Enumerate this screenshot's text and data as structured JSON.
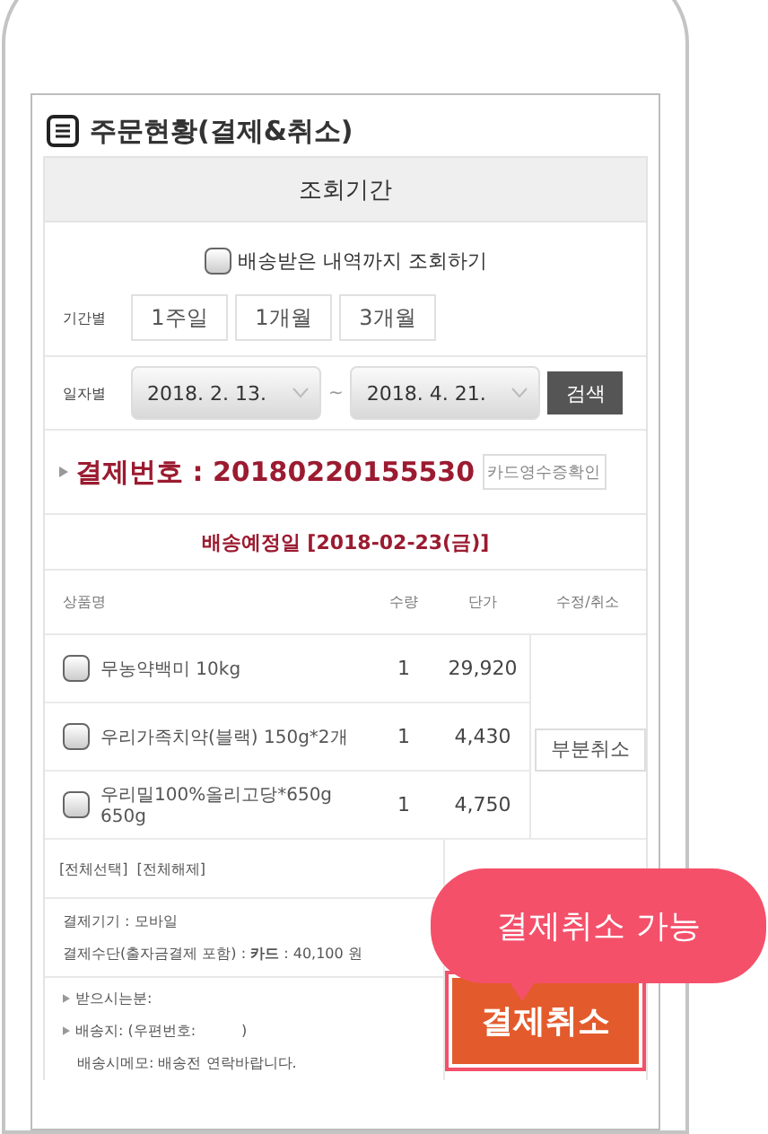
{
  "page_title": "주문현황(결제&취소)",
  "period_header": "조회기간",
  "include_delivered": {
    "label": "배송받은 내역까지 조회하기",
    "checked": false
  },
  "period_filter": {
    "label": "기간별",
    "options": [
      {
        "label": "1주일",
        "selected": false
      },
      {
        "label": "1개월",
        "selected": false
      },
      {
        "label": "3개월",
        "selected": false
      }
    ]
  },
  "date_filter": {
    "label": "일자별",
    "from": "2018. 2. 13.",
    "separator": "~",
    "to": "2018. 4. 21.",
    "search_button": "검색"
  },
  "payment": {
    "number": "결제번호 : 20180220155530",
    "receipt_button": "카드영수증확인",
    "delivery_date": "배송예정일 [2018-02-23(금)]"
  },
  "table": {
    "columns": [
      "상품명",
      "수량",
      "단가",
      "수정/취소"
    ],
    "rows": [
      {
        "name": "무농약백미 10kg",
        "qty": "1",
        "price": "29,920",
        "checked": false
      },
      {
        "name": "우리가족치약(블랙) 150g*2개",
        "qty": "1",
        "price": "4,430",
        "checked": false
      },
      {
        "name": "우리밀100%올리고당*650g 650g",
        "qty": "1",
        "price": "4,750",
        "checked": false
      }
    ],
    "partial_cancel_button": "부분취소"
  },
  "bulk_actions": [
    "[전체선택]",
    "[전체해제]"
  ],
  "payment_info": [
    "결제기기 : 모바일",
    "결제수단(출자금결제 포함) : **카드** : 40,100 원"
  ],
  "delivery_info": [
    {
      "text": "받으시는분:",
      "bullet": true
    },
    {
      "text": "배송지: (우편번호:          )",
      "bullet": true
    },
    {
      "text": "배송시메모: 배송전 연락바랍니다.",
      "bullet": false
    }
  ],
  "cancel_button": "결제취소",
  "tooltip": "결제취소 가능"
}
